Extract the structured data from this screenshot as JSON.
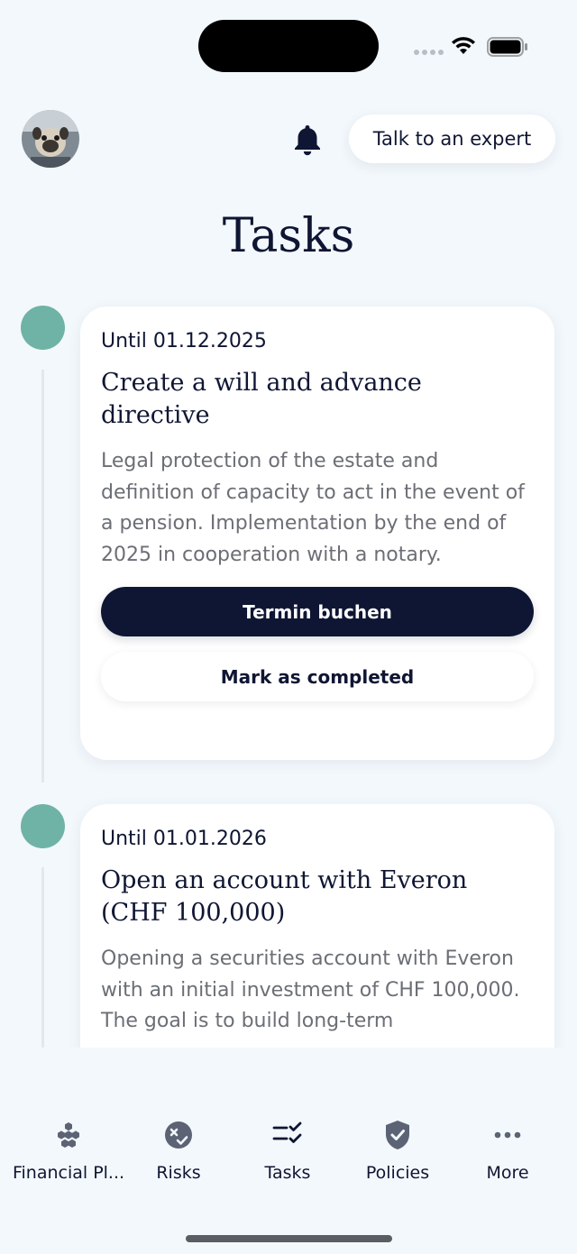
{
  "header": {
    "expert_button": "Talk to an expert",
    "title": "Tasks"
  },
  "tasks": [
    {
      "due": "Until 01.12.2025",
      "title": "Create a will and advance directive",
      "description": "Legal protection of the estate and definition of capacity to act in the event of a pension. Implementation by the end of 2025 in cooperation with a notary.",
      "primary_action": "Termin buchen",
      "secondary_action": "Mark as completed"
    },
    {
      "due": "Until 01.01.2026",
      "title": "Open an account with Everon (CHF 100,000)",
      "description": "Opening a securities account with Everon with an initial investment of CHF 100,000. The goal is to build long-term"
    }
  ],
  "tabbar": {
    "items": [
      {
        "label": "Financial Pl...",
        "icon": "hexagon-cluster-icon"
      },
      {
        "label": "Risks",
        "icon": "risk-shield-icon"
      },
      {
        "label": "Tasks",
        "icon": "checklist-icon"
      },
      {
        "label": "Policies",
        "icon": "shield-check-icon"
      },
      {
        "label": "More",
        "icon": "more-dots-icon"
      }
    ]
  },
  "colors": {
    "background": "#f3f8fc",
    "primary": "#0f1633",
    "timeline_dot": "#6fb3a6",
    "muted_text": "#6b6f75"
  }
}
